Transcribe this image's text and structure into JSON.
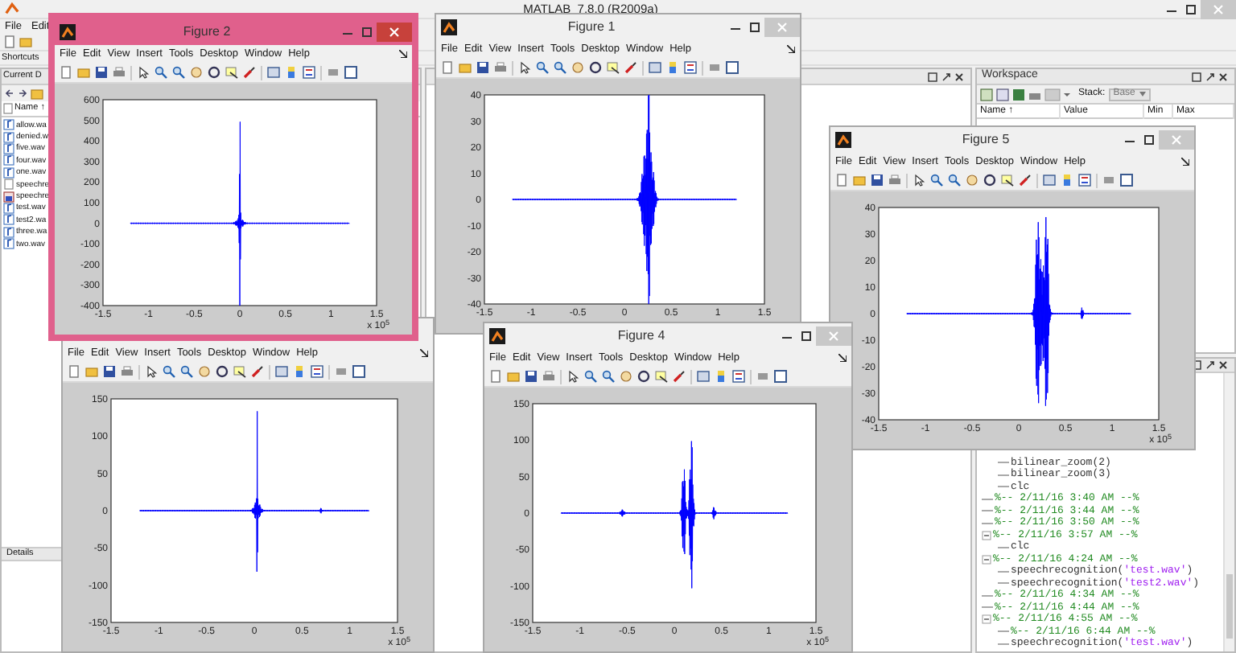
{
  "main_window": {
    "title": "MATLAB  7.8.0 (R2009a)",
    "menu": [
      "File",
      "Edit"
    ],
    "shortcuts": "Shortcuts"
  },
  "current_directory": {
    "title": "Current D",
    "column": "Name ↑",
    "details": "Details",
    "files": [
      {
        "name": "allow.wa",
        "kind": "audio"
      },
      {
        "name": "denied.w",
        "kind": "audio"
      },
      {
        "name": "five.wav",
        "kind": "audio"
      },
      {
        "name": "four.wav",
        "kind": "audio"
      },
      {
        "name": "one.wav",
        "kind": "audio"
      },
      {
        "name": "speechre",
        "kind": "script"
      },
      {
        "name": "speechre",
        "kind": "figure"
      },
      {
        "name": "test.wav",
        "kind": "audio"
      },
      {
        "name": "test2.wa",
        "kind": "audio"
      },
      {
        "name": "three.wa",
        "kind": "audio"
      },
      {
        "name": "two.wav",
        "kind": "audio"
      }
    ]
  },
  "workspace": {
    "title": "Workspace",
    "stack_label": "Stack:",
    "stack_value": "Base",
    "columns": [
      "Name ↑",
      "Value",
      "Min",
      "Max"
    ]
  },
  "command_history": [
    {
      "kind": "command",
      "text": "bilinear_zoom(2)"
    },
    {
      "kind": "command",
      "text": "bilinear_zoom(3)"
    },
    {
      "kind": "command",
      "text": "clc"
    },
    {
      "kind": "session",
      "text": "%-- 2/11/16  3:40 AM --%"
    },
    {
      "kind": "session",
      "text": "%-- 2/11/16  3:44 AM --%"
    },
    {
      "kind": "session",
      "text": "%-- 2/11/16  3:50 AM --%"
    },
    {
      "kind": "session",
      "text": "%-- 2/11/16  3:57 AM --%",
      "expanded": true,
      "children": [
        {
          "kind": "command",
          "text": "clc"
        }
      ]
    },
    {
      "kind": "session",
      "text": "%-- 2/11/16  4:24 AM --%",
      "expanded": true,
      "children": [
        {
          "kind": "command",
          "text": "speechrecognition(",
          "string": "'test.wav'",
          "tail": ")"
        },
        {
          "kind": "command",
          "text": "speechrecognition(",
          "string": "'test2.wav'",
          "tail": ")"
        }
      ]
    },
    {
      "kind": "session",
      "text": "%-- 2/11/16  4:34 AM --%"
    },
    {
      "kind": "session",
      "text": "%-- 2/11/16  4:44 AM --%"
    },
    {
      "kind": "session",
      "text": "%-- 2/11/16  4:55 AM --%",
      "expanded": true,
      "children": [
        {
          "kind": "session",
          "text": "%-- 2/11/16  6:44 AM --%"
        },
        {
          "kind": "command",
          "text": "speechrecognition(",
          "string": "'test.wav'",
          "tail": ")"
        }
      ]
    }
  ],
  "figures": [
    {
      "title": "Figure 2",
      "selected": true,
      "menu": [
        "File",
        "Edit",
        "View",
        "Insert",
        "Tools",
        "Desktop",
        "Window",
        "Help"
      ],
      "yticks": [
        "600",
        "500",
        "400",
        "300",
        "200",
        "100",
        "0",
        "-100",
        "-200",
        "-300",
        "-400"
      ],
      "xticks": [
        "-1.5",
        "-1",
        "-0.5",
        "0",
        "0.5",
        "1",
        "1.5"
      ],
      "exponent": "x 10$^{5}$"
    },
    {
      "title": "Figure 1",
      "selected": false,
      "menu": [
        "File",
        "Edit",
        "View",
        "Insert",
        "Tools",
        "Desktop",
        "Window",
        "Help"
      ],
      "yticks": [
        "40",
        "30",
        "20",
        "10",
        "0",
        "-10",
        "-20",
        "-30",
        "-40"
      ],
      "xticks": [
        "-1.5",
        "-1",
        "-0.5",
        "0",
        "0.5",
        "1",
        "1.5"
      ]
    },
    {
      "title": "Figure 5",
      "selected": false,
      "menu": [
        "File",
        "Edit",
        "View",
        "Insert",
        "Tools",
        "Desktop",
        "Window",
        "Help"
      ],
      "yticks": [
        "40",
        "30",
        "20",
        "10",
        "0",
        "-10",
        "-20",
        "-30",
        "-40"
      ],
      "xticks": [
        "-1.5",
        "-1",
        "-0.5",
        "0",
        "0.5",
        "1",
        "1.5"
      ],
      "exponent": "x 10$^{5}$"
    },
    {
      "selected": false,
      "menu": [
        "File",
        "Edit",
        "View",
        "Insert",
        "Tools",
        "Desktop",
        "Window",
        "Help"
      ],
      "yticks": [
        "150",
        "100",
        "50",
        "0",
        "-50",
        "-100",
        "-150"
      ],
      "xticks": [
        "-1.5",
        "-1",
        "-0.5",
        "0",
        "0.5",
        "1",
        "1.5"
      ],
      "exponent": "x 10$^{5}$"
    },
    {
      "title": "Figure 4",
      "selected": false,
      "menu": [
        "File",
        "Edit",
        "View",
        "Insert",
        "Tools",
        "Desktop",
        "Window",
        "Help"
      ],
      "yticks": [
        "150",
        "100",
        "50",
        "0",
        "-50",
        "-100",
        "-150"
      ],
      "xticks": [
        "-1.5",
        "-1",
        "-0.5",
        "0",
        "0.5",
        "1",
        "1.5"
      ],
      "exponent": "x 10$^{5}$"
    }
  ]
}
